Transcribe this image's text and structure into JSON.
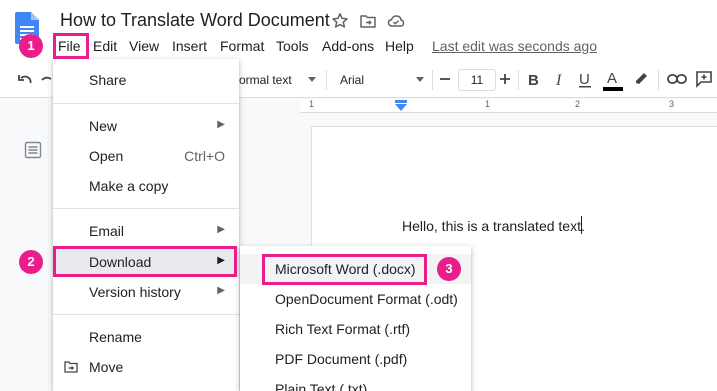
{
  "doc": {
    "title": "How to Translate Word Document",
    "last_edit": "Last edit was seconds ago"
  },
  "menubar": {
    "items": [
      "File",
      "Edit",
      "View",
      "Insert",
      "Format",
      "Tools",
      "Add-ons",
      "Help"
    ]
  },
  "toolbar": {
    "style": "Normal text",
    "style_visible": "ormal text",
    "font": "Arial",
    "font_size": "11",
    "icons": [
      "undo-icon",
      "redo-icon",
      "decrease-font-size-icon",
      "increase-font-size-icon",
      "bold-icon",
      "italic-icon",
      "underline-icon",
      "text-color-icon",
      "highlight-icon",
      "link-icon",
      "comment-icon"
    ]
  },
  "ruler": {
    "ticks": [
      "1",
      "1",
      "2",
      "3"
    ]
  },
  "page": {
    "text": "Hello, this is a translated text."
  },
  "file_menu": {
    "items": [
      {
        "label": "Share"
      },
      {
        "label": "New",
        "submenu": true
      },
      {
        "label": "Open",
        "shortcut": "Ctrl+O"
      },
      {
        "label": "Make a copy"
      },
      {
        "label": "Email",
        "submenu": true
      },
      {
        "label": "Download",
        "submenu": true,
        "highlighted": true
      },
      {
        "label": "Version history",
        "submenu": true
      },
      {
        "label": "Rename"
      },
      {
        "label": "Move",
        "icon": "move-icon"
      }
    ]
  },
  "download_menu": {
    "items": [
      {
        "label": "Microsoft Word (.docx)",
        "highlighted": true
      },
      {
        "label": "OpenDocument Format (.odt)"
      },
      {
        "label": "Rich Text Format (.rtf)"
      },
      {
        "label": "PDF Document (.pdf)"
      },
      {
        "label": "Plain Text (.txt)"
      }
    ]
  },
  "steps": [
    "1",
    "2",
    "3"
  ],
  "colors": {
    "highlight": "#e91e8c",
    "docs_blue": "#4285f4",
    "text": "#202124",
    "muted": "#5f6368"
  }
}
